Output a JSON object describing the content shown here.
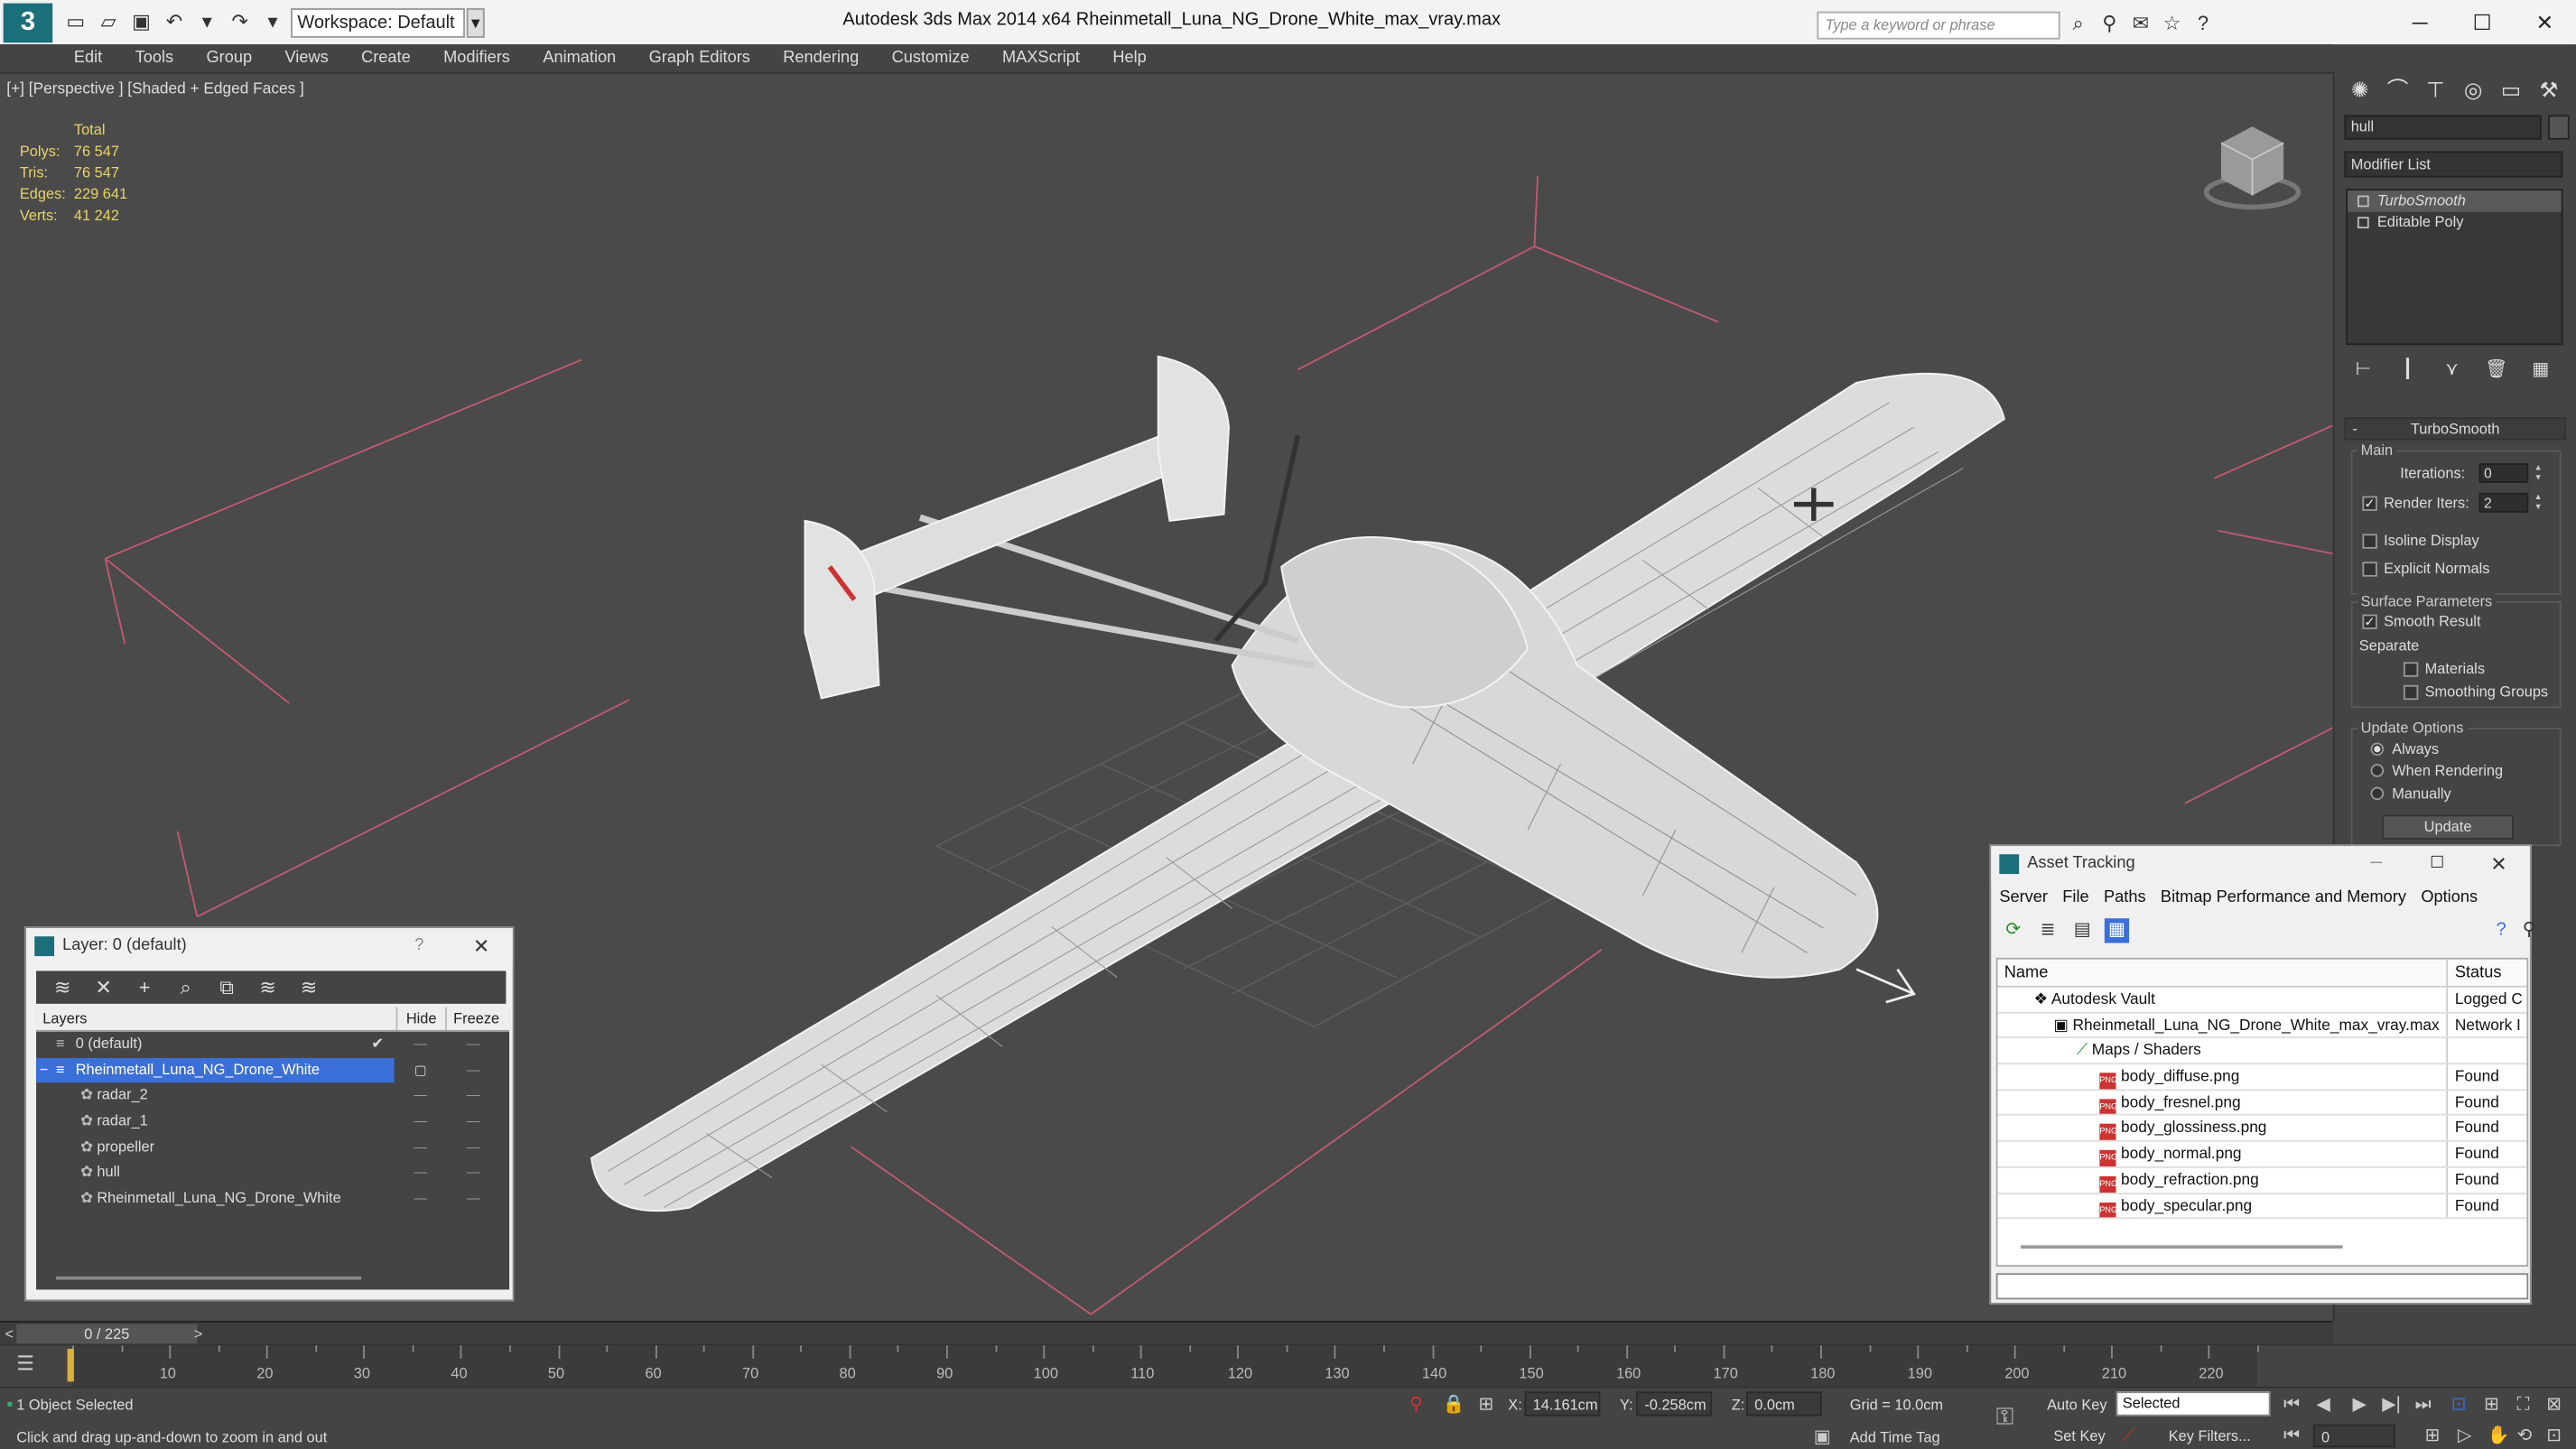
{
  "titlebar": {
    "workspace": "Workspace: Default",
    "app_title": "Autodesk 3ds Max  2014 x64",
    "file_title": "Rheinmetall_Luna_NG_Drone_White_max_vray.max",
    "search_placeholder": "Type a keyword or phrase"
  },
  "menu": [
    "Edit",
    "Tools",
    "Group",
    "Views",
    "Create",
    "Modifiers",
    "Animation",
    "Graph Editors",
    "Rendering",
    "Customize",
    "MAXScript",
    "Help"
  ],
  "viewport": {
    "label": "[+] [Perspective ] [Shaded + Edged Faces ]",
    "stats": {
      "header": "Total",
      "rows": [
        {
          "k": "Polys:",
          "v": "76 547"
        },
        {
          "k": "Tris:",
          "v": "76 547"
        },
        {
          "k": "Edges:",
          "v": "229 641"
        },
        {
          "k": "Verts:",
          "v": "41 242"
        }
      ]
    }
  },
  "command_panel": {
    "object_name": "hull",
    "modifier_list": "Modifier List",
    "stack": [
      "TurboSmooth",
      "Editable Poly"
    ],
    "rollout_title": "TurboSmooth",
    "main_label": "Main",
    "iterations_label": "Iterations:",
    "iterations_value": "0",
    "render_iters_label": "Render Iters:",
    "render_iters_value": "2",
    "isoline": "Isoline Display",
    "explicit_normals": "Explicit Normals",
    "surface_params": "Surface Parameters",
    "smooth_result": "Smooth Result",
    "separate": "Separate",
    "materials": "Materials",
    "smoothing_groups": "Smoothing Groups",
    "update_options": "Update Options",
    "always": "Always",
    "when_rendering": "When Rendering",
    "manually": "Manually",
    "update_button": "Update"
  },
  "layer_dialog": {
    "title": "Layer: 0 (default)",
    "help": "?",
    "col_layers": "Layers",
    "col_hide": "Hide",
    "col_freeze": "Freeze",
    "rows": [
      {
        "name": "0 (default)",
        "indent": 0,
        "selected": false
      },
      {
        "name": "Rheinmetall_Luna_NG_Drone_White",
        "indent": 0,
        "selected": true
      },
      {
        "name": "radar_2",
        "indent": 1,
        "selected": false
      },
      {
        "name": "radar_1",
        "indent": 1,
        "selected": false
      },
      {
        "name": "propeller",
        "indent": 1,
        "selected": false
      },
      {
        "name": "hull",
        "indent": 1,
        "selected": false
      },
      {
        "name": "Rheinmetall_Luna_NG_Drone_White",
        "indent": 1,
        "selected": false
      }
    ]
  },
  "asset_tracking": {
    "title": "Asset Tracking",
    "menu": [
      "Server",
      "File",
      "Paths",
      "Bitmap Performance and Memory",
      "Options"
    ],
    "col_name": "Name",
    "col_status": "Status",
    "rows": [
      {
        "name": "Autodesk Vault",
        "status": "Logged C",
        "indent": 1,
        "icon": "vault"
      },
      {
        "name": "Rheinmetall_Luna_NG_Drone_White_max_vray.max",
        "status": "Network I",
        "indent": 2,
        "icon": "max"
      },
      {
        "name": "Maps / Shaders",
        "status": "",
        "indent": 3,
        "icon": "folder"
      },
      {
        "name": "body_diffuse.png",
        "status": "Found",
        "indent": 4,
        "icon": "png"
      },
      {
        "name": "body_fresnel.png",
        "status": "Found",
        "indent": 4,
        "icon": "png"
      },
      {
        "name": "body_glossiness.png",
        "status": "Found",
        "indent": 4,
        "icon": "png"
      },
      {
        "name": "body_normal.png",
        "status": "Found",
        "indent": 4,
        "icon": "png"
      },
      {
        "name": "body_refraction.png",
        "status": "Found",
        "indent": 4,
        "icon": "png"
      },
      {
        "name": "body_specular.png",
        "status": "Found",
        "indent": 4,
        "icon": "png"
      }
    ]
  },
  "timeline": {
    "frame": "0 / 225",
    "ticks": [
      "10",
      "20",
      "30",
      "40",
      "50",
      "60",
      "70",
      "80",
      "90",
      "100",
      "110",
      "120",
      "130",
      "140",
      "150",
      "160",
      "170",
      "180",
      "190",
      "200",
      "210",
      "220"
    ]
  },
  "status": {
    "selection": "1 Object Selected",
    "prompt": "Click and drag up-and-down to zoom in and out",
    "x_label": "X:",
    "x": "14.161cm",
    "y_label": "Y:",
    "y": "-0.258cm",
    "z_label": "Z:",
    "z": "0.0cm",
    "grid": "Grid = 10.0cm",
    "auto_key": "Auto Key",
    "selected": "Selected",
    "set_key": "Set Key",
    "key_filters": "Key Filters...",
    "add_time_tag": "Add Time Tag",
    "frame_field": "0"
  },
  "colors": {
    "accent": "#1b6f7a",
    "stats_yellow": "#e8d36b",
    "layer_selection": "#3b6fd8",
    "light_lines": "#d06078"
  }
}
